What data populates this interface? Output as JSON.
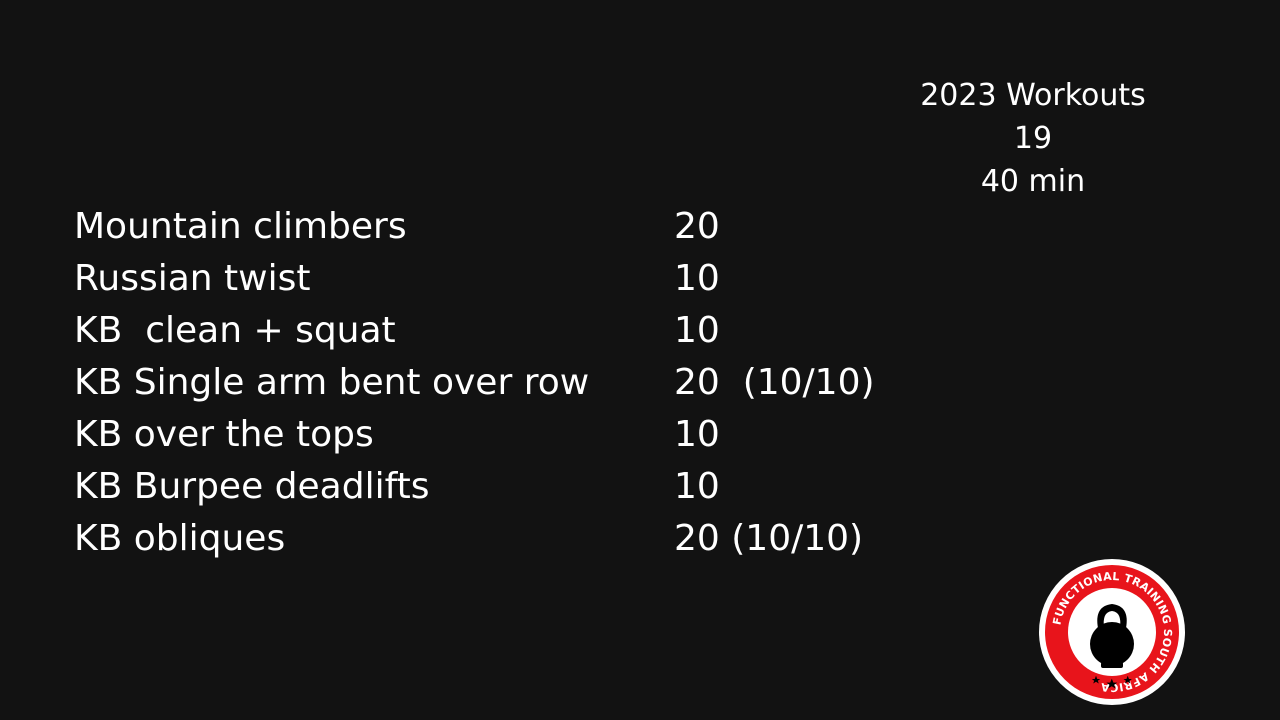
{
  "header": {
    "title": "2023 Workouts",
    "number": "19",
    "duration": "40 min"
  },
  "exercises": [
    {
      "name": "Mountain climbers",
      "reps": "20"
    },
    {
      "name": "Russian twist",
      "reps": "10"
    },
    {
      "name": "KB  clean + squat",
      "reps": "10"
    },
    {
      "name": "KB Single arm bent over row",
      "reps": "20  (10/10)"
    },
    {
      "name": "KB over the tops",
      "reps": "10"
    },
    {
      "name": "KB Burpee deadlifts",
      "reps": "10"
    },
    {
      "name": "KB obliques",
      "reps": "20 (10/10)"
    }
  ],
  "logo": {
    "text": "FUNCTIONAL TRAINING SOUTH AFRICA",
    "ring_color": "#e8141b",
    "icon": "kettlebell-icon"
  }
}
